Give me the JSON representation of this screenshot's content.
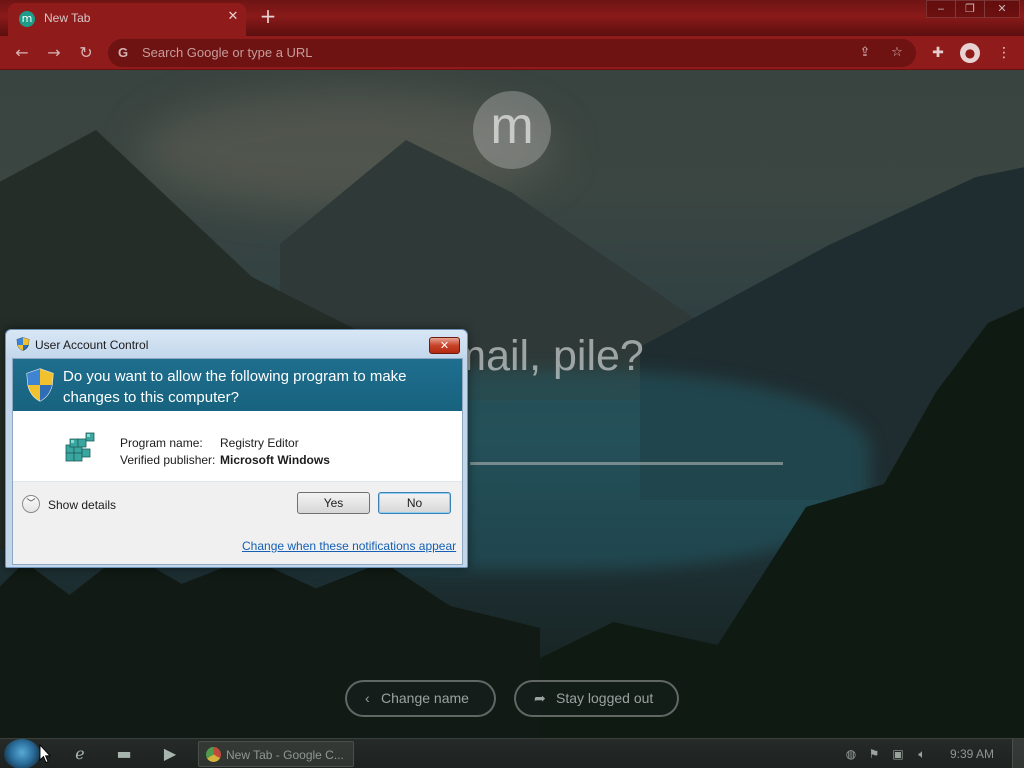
{
  "browser": {
    "tab_title": "New Tab",
    "tab_favicon_letter": "m",
    "omnibox_placeholder": "Search Google or type a URL"
  },
  "newtab": {
    "avatar_letter": "m",
    "question_text": "ur email, pile?",
    "change_name_label": "Change name",
    "stay_logged_out_label": "Stay logged out"
  },
  "uac": {
    "window_title": "User Account Control",
    "close_glyph": "✕",
    "question": "Do you want to allow the following program to make changes to this computer?",
    "program_name_label": "Program name:",
    "program_name_value": "Registry Editor",
    "publisher_label": "Verified publisher:",
    "publisher_value": "Microsoft Windows",
    "show_details_label": "Show details",
    "yes_label": "Yes",
    "no_label": "No",
    "change_link": "Change when these notifications appear"
  },
  "taskbar": {
    "task_label": "New Tab - Google C...",
    "clock": "9:39 AM"
  },
  "colors": {
    "chrome_theme": "#8f1b1b",
    "uac_header": "#17637f",
    "link": "#1560b4"
  }
}
